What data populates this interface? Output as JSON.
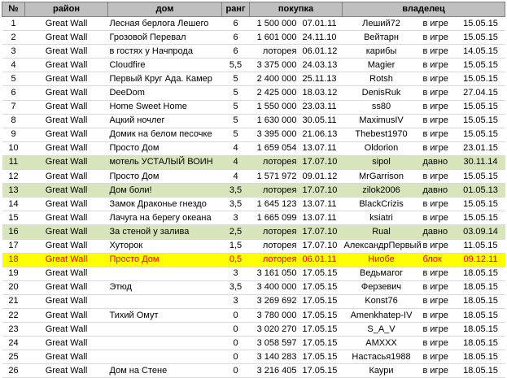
{
  "headers": {
    "num": "№",
    "district": "район",
    "house": "дом",
    "rank": "ранг",
    "purchase": "покупка",
    "owner": "владелец"
  },
  "rows": [
    {
      "num": "1",
      "district": "Great Wall",
      "house": "Лесная берлога Лешего",
      "rank": "6",
      "price": "1 500 000",
      "pdate": "07.01.11",
      "owner": "Леший72",
      "status": "в игре",
      "odate": "15.05.15",
      "hl": ""
    },
    {
      "num": "2",
      "district": "Great Wall",
      "house": "Грозовой Перевал",
      "rank": "6",
      "price": "1 601 000",
      "pdate": "24.11.10",
      "owner": "Вейтарн",
      "status": "в игре",
      "odate": "15.05.15",
      "hl": ""
    },
    {
      "num": "3",
      "district": "Great Wall",
      "house": "в гостях у Начпрода",
      "rank": "6",
      "price": "лоторея",
      "pdate": "06.01.12",
      "owner": "карибы",
      "status": "в игре",
      "odate": "14.05.15",
      "hl": ""
    },
    {
      "num": "4",
      "district": "Great Wall",
      "house": "Cloudfire",
      "rank": "5,5",
      "price": "3 375 000",
      "pdate": "24.03.13",
      "owner": "Magier",
      "status": "в игре",
      "odate": "15.05.15",
      "hl": ""
    },
    {
      "num": "5",
      "district": "Great Wall",
      "house": "Первый Круг Ада. Камер",
      "rank": "5",
      "price": "2 400 000",
      "pdate": "25.11.13",
      "owner": "Rotsh",
      "status": "в игре",
      "odate": "15.05.15",
      "hl": ""
    },
    {
      "num": "6",
      "district": "Great Wall",
      "house": "DeeDom",
      "rank": "5",
      "price": "2 425 000",
      "pdate": "18.03.12",
      "owner": "DenisRuk",
      "status": "в игре",
      "odate": "27.04.15",
      "hl": ""
    },
    {
      "num": "7",
      "district": "Great Wall",
      "house": "Home Sweet Home",
      "rank": "5",
      "price": "1 550 000",
      "pdate": "23.03.11",
      "owner": "ss80",
      "status": "в игре",
      "odate": "15.05.15",
      "hl": ""
    },
    {
      "num": "8",
      "district": "Great Wall",
      "house": "Ацкий ночлег",
      "rank": "5",
      "price": "1 630 000",
      "pdate": "30.05.11",
      "owner": "MaximusIV",
      "status": "в игре",
      "odate": "15.05.15",
      "hl": ""
    },
    {
      "num": "9",
      "district": "Great Wall",
      "house": "Домик на белом песочке",
      "rank": "5",
      "price": "3 395 000",
      "pdate": "21.06.13",
      "owner": "Thebest1970",
      "status": "в игре",
      "odate": "15.05.15",
      "hl": ""
    },
    {
      "num": "10",
      "district": "Great Wall",
      "house": "Просто Дом",
      "rank": "4",
      "price": "1 659 054",
      "pdate": "13.07.11",
      "owner": "Oldorion",
      "status": "в игре",
      "odate": "23.01.15",
      "hl": ""
    },
    {
      "num": "11",
      "district": "Great Wall",
      "house": "мотель УСТАЛЫЙ ВОИН",
      "rank": "4",
      "price": "лоторея",
      "pdate": "17.07.10",
      "owner": "sipol",
      "status": "давно",
      "odate": "30.11.14",
      "hl": "green"
    },
    {
      "num": "12",
      "district": "Great Wall",
      "house": "Просто Дом",
      "rank": "4",
      "price": "1 571 972",
      "pdate": "09.01.12",
      "owner": "MrGarrison",
      "status": "в игре",
      "odate": "15.05.15",
      "hl": ""
    },
    {
      "num": "13",
      "district": "Great Wall",
      "house": "Дом боли!",
      "rank": "3,5",
      "price": "лоторея",
      "pdate": "17.07.10",
      "owner": "zilok2006",
      "status": "давно",
      "odate": "01.05.13",
      "hl": "green"
    },
    {
      "num": "14",
      "district": "Great Wall",
      "house": "Замок Драконье гнездо",
      "rank": "3,5",
      "price": "1 645 123",
      "pdate": "13.07.11",
      "owner": "BlackCrizis",
      "status": "в игре",
      "odate": "15.05.15",
      "hl": ""
    },
    {
      "num": "15",
      "district": "Great Wall",
      "house": "Лачуга на берегу океана",
      "rank": "3",
      "price": "1 665 099",
      "pdate": "13.07.11",
      "owner": "ksiatri",
      "status": "в игре",
      "odate": "15.05.15",
      "hl": ""
    },
    {
      "num": "16",
      "district": "Great Wall",
      "house": "За стеной у залива",
      "rank": "2,5",
      "price": "лоторея",
      "pdate": "17.07.10",
      "owner": "Rual",
      "status": "давно",
      "odate": "03.09.14",
      "hl": "green"
    },
    {
      "num": "17",
      "district": "Great Wall",
      "house": "Хуторок",
      "rank": "1,5",
      "price": "лоторея",
      "pdate": "17.07.10",
      "owner": "АлександрПервый",
      "status": "в игре",
      "odate": "11.05.15",
      "hl": ""
    },
    {
      "num": "18",
      "district": "Great Wall",
      "house": "Просто Дом",
      "rank": "0,5",
      "price": "лоторея",
      "pdate": "06.01.11",
      "owner": "Ниобе",
      "status": "блок",
      "odate": "09.12.11",
      "hl": "yellow"
    },
    {
      "num": "19",
      "district": "Great Wall",
      "house": "",
      "rank": "3",
      "price": "3 161 050",
      "pdate": "17.05.15",
      "owner": "Ведьмагог",
      "status": "в игре",
      "odate": "18.05.15",
      "hl": ""
    },
    {
      "num": "20",
      "district": "Great Wall",
      "house": "Этюд",
      "rank": "3,5",
      "price": "3 400 000",
      "pdate": "17.05.15",
      "owner": "Ферзевич",
      "status": "в игре",
      "odate": "18.05.15",
      "hl": ""
    },
    {
      "num": "21",
      "district": "Great Wall",
      "house": "",
      "rank": "3",
      "price": "3 269 692",
      "pdate": "17.05.15",
      "owner": "Konst76",
      "status": "в игре",
      "odate": "18.05.15",
      "hl": ""
    },
    {
      "num": "22",
      "district": "Great Wall",
      "house": "Тихий Омут",
      "rank": "0",
      "price": "3 780 000",
      "pdate": "17.05.15",
      "owner": "Amenkhatep-IV",
      "status": "в игре",
      "odate": "18.05.15",
      "hl": ""
    },
    {
      "num": "23",
      "district": "Great Wall",
      "house": "",
      "rank": "0",
      "price": "3 020 270",
      "pdate": "17.05.15",
      "owner": "S_A_V",
      "status": "в игре",
      "odate": "18.05.15",
      "hl": ""
    },
    {
      "num": "24",
      "district": "Great Wall",
      "house": "",
      "rank": "0",
      "price": "3 058 597",
      "pdate": "17.05.15",
      "owner": "AMXXX",
      "status": "в игре",
      "odate": "18.05.15",
      "hl": ""
    },
    {
      "num": "25",
      "district": "Great Wall",
      "house": "",
      "rank": "0",
      "price": "3 140 283",
      "pdate": "17.05.15",
      "owner": "Настасья1988",
      "status": "в игре",
      "odate": "18.05.15",
      "hl": ""
    },
    {
      "num": "26",
      "district": "Great Wall",
      "house": "Дом на Стене",
      "rank": "0",
      "price": "3 216 405",
      "pdate": "17.05.15",
      "owner": "Каури",
      "status": "в игре",
      "odate": "18.05.15",
      "hl": ""
    }
  ]
}
